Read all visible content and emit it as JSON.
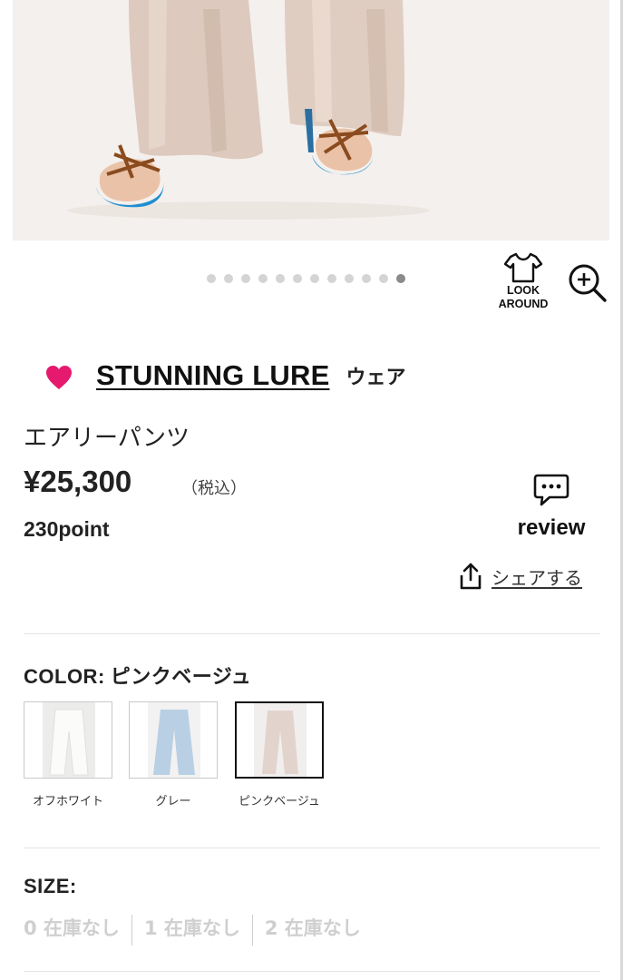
{
  "carousel": {
    "total": 12,
    "active": 11
  },
  "look_around": {
    "line1": "LOOK",
    "line2": "AROUND"
  },
  "brand": {
    "name": "STUNNING LURE",
    "category": "ウェア"
  },
  "product": {
    "name": "エアリーパンツ",
    "price": "¥25,300",
    "tax": "（税込）",
    "points": "230point"
  },
  "review": {
    "label": "review"
  },
  "share": {
    "label": "シェアする"
  },
  "color": {
    "label": "COLOR:",
    "selected": "ピンクベージュ",
    "options": [
      {
        "label": "オフホワイト",
        "color": "#eeeeec"
      },
      {
        "label": "グレー",
        "color": "#b9cfe3"
      },
      {
        "label": "ピンクベージュ",
        "color": "#e2d4cd"
      }
    ]
  },
  "size": {
    "label": "SIZE:",
    "options": [
      {
        "label": "0 在庫なし"
      },
      {
        "label": "1 在庫なし"
      },
      {
        "label": "2 在庫なし"
      }
    ]
  },
  "colors": {
    "accent_heart": "#e5196d",
    "text": "#222222",
    "muted": "#cfcfcf"
  }
}
